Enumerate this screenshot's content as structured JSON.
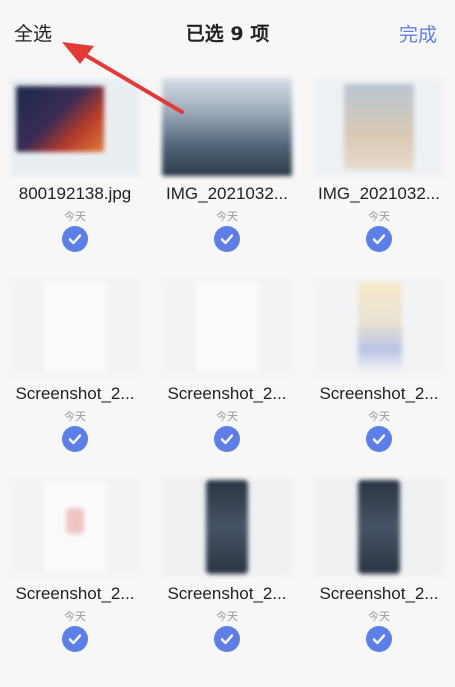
{
  "header": {
    "select_all": "全选",
    "title": "已选 9 项",
    "done": "完成"
  },
  "colors": {
    "accent": "#5b7fe6",
    "background": "#f7f7f8"
  },
  "files": [
    {
      "name": "800192138.jpg",
      "date": "今天",
      "selected": true,
      "thumb_style": "photo-dark"
    },
    {
      "name": "IMG_2021032...",
      "date": "今天",
      "selected": true,
      "thumb_style": "photo-blue"
    },
    {
      "name": "IMG_2021032...",
      "date": "今天",
      "selected": true,
      "thumb_style": "photo-light"
    },
    {
      "name": "Screenshot_2...",
      "date": "今天",
      "selected": true,
      "thumb_style": "screen-white"
    },
    {
      "name": "Screenshot_2...",
      "date": "今天",
      "selected": true,
      "thumb_style": "screen-white"
    },
    {
      "name": "Screenshot_2...",
      "date": "今天",
      "selected": true,
      "thumb_style": "screen-beige"
    },
    {
      "name": "Screenshot_2...",
      "date": "今天",
      "selected": true,
      "thumb_style": "screen-pink"
    },
    {
      "name": "Screenshot_2...",
      "date": "今天",
      "selected": true,
      "thumb_style": "phone-dark"
    },
    {
      "name": "Screenshot_2...",
      "date": "今天",
      "selected": true,
      "thumb_style": "phone-dark"
    }
  ]
}
